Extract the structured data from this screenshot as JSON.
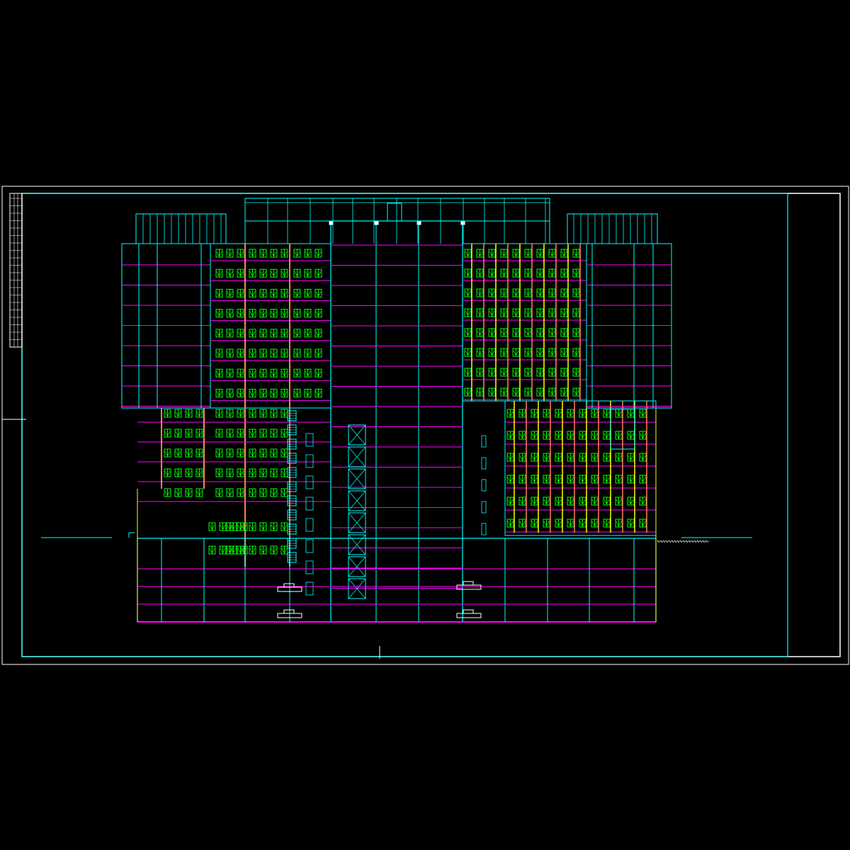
{
  "canvas": {
    "background": "#000000"
  },
  "colors": {
    "sheet_border": "#ffffff",
    "frame": "#00ffff",
    "floor_line": "#ff00ff",
    "window": "#00ff00",
    "mullion_orange": "#ff8060",
    "mullion_yellow": "#ffff00",
    "stair": "#00ffff",
    "ground": "#00ffff"
  },
  "drawing": {
    "type": "building-elevation",
    "title_block_text": []
  }
}
